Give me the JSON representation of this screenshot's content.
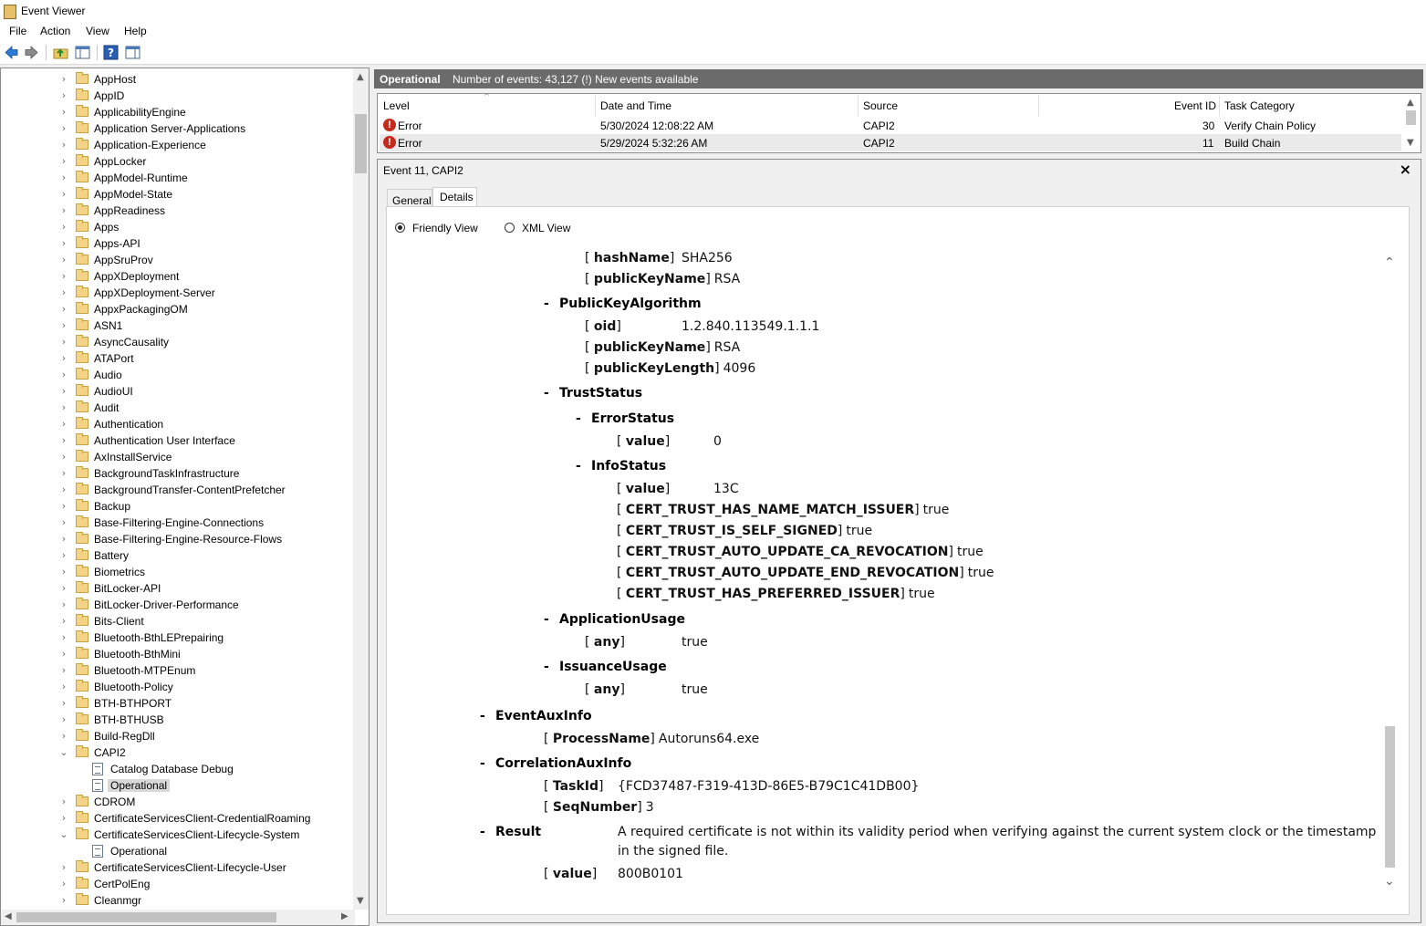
{
  "window": {
    "title": "Event Viewer"
  },
  "menu": [
    "File",
    "Action",
    "View",
    "Help"
  ],
  "toolbar": [
    "back-icon",
    "forward-icon",
    "folder-up-icon",
    "console-tree-icon",
    "help-icon",
    "action-pane-icon"
  ],
  "tree": {
    "items": [
      {
        "label": "AppHost",
        "type": "folder",
        "expanded": false
      },
      {
        "label": "AppID",
        "type": "folder",
        "expanded": false
      },
      {
        "label": "ApplicabilityEngine",
        "type": "folder",
        "expanded": false
      },
      {
        "label": "Application Server-Applications",
        "type": "folder",
        "expanded": false
      },
      {
        "label": "Application-Experience",
        "type": "folder",
        "expanded": false
      },
      {
        "label": "AppLocker",
        "type": "folder",
        "expanded": false
      },
      {
        "label": "AppModel-Runtime",
        "type": "folder",
        "expanded": false
      },
      {
        "label": "AppModel-State",
        "type": "folder",
        "expanded": false
      },
      {
        "label": "AppReadiness",
        "type": "folder",
        "expanded": false
      },
      {
        "label": "Apps",
        "type": "folder",
        "expanded": false
      },
      {
        "label": "Apps-API",
        "type": "folder",
        "expanded": false
      },
      {
        "label": "AppSruProv",
        "type": "folder",
        "expanded": false
      },
      {
        "label": "AppXDeployment",
        "type": "folder",
        "expanded": false
      },
      {
        "label": "AppXDeployment-Server",
        "type": "folder",
        "expanded": false
      },
      {
        "label": "AppxPackagingOM",
        "type": "folder",
        "expanded": false
      },
      {
        "label": "ASN1",
        "type": "folder",
        "expanded": false
      },
      {
        "label": "AsyncCausality",
        "type": "folder",
        "expanded": false
      },
      {
        "label": "ATAPort",
        "type": "folder",
        "expanded": false
      },
      {
        "label": "Audio",
        "type": "folder",
        "expanded": false
      },
      {
        "label": "AudioUI",
        "type": "folder",
        "expanded": false
      },
      {
        "label": "Audit",
        "type": "folder",
        "expanded": false
      },
      {
        "label": "Authentication",
        "type": "folder",
        "expanded": false
      },
      {
        "label": "Authentication User Interface",
        "type": "folder",
        "expanded": false
      },
      {
        "label": "AxInstallService",
        "type": "folder",
        "expanded": false
      },
      {
        "label": "BackgroundTaskInfrastructure",
        "type": "folder",
        "expanded": false
      },
      {
        "label": "BackgroundTransfer-ContentPrefetcher",
        "type": "folder",
        "expanded": false
      },
      {
        "label": "Backup",
        "type": "folder",
        "expanded": false
      },
      {
        "label": "Base-Filtering-Engine-Connections",
        "type": "folder",
        "expanded": false
      },
      {
        "label": "Base-Filtering-Engine-Resource-Flows",
        "type": "folder",
        "expanded": false
      },
      {
        "label": "Battery",
        "type": "folder",
        "expanded": false
      },
      {
        "label": "Biometrics",
        "type": "folder",
        "expanded": false
      },
      {
        "label": "BitLocker-API",
        "type": "folder",
        "expanded": false
      },
      {
        "label": "BitLocker-Driver-Performance",
        "type": "folder",
        "expanded": false
      },
      {
        "label": "Bits-Client",
        "type": "folder",
        "expanded": false
      },
      {
        "label": "Bluetooth-BthLEPrepairing",
        "type": "folder",
        "expanded": false
      },
      {
        "label": "Bluetooth-BthMini",
        "type": "folder",
        "expanded": false
      },
      {
        "label": "Bluetooth-MTPEnum",
        "type": "folder",
        "expanded": false
      },
      {
        "label": "Bluetooth-Policy",
        "type": "folder",
        "expanded": false
      },
      {
        "label": "BTH-BTHPORT",
        "type": "folder",
        "expanded": false
      },
      {
        "label": "BTH-BTHUSB",
        "type": "folder",
        "expanded": false
      },
      {
        "label": "Build-RegDll",
        "type": "folder",
        "expanded": false
      },
      {
        "label": "CAPI2",
        "type": "folder",
        "expanded": true
      },
      {
        "label": "Catalog Database Debug",
        "type": "log-debug",
        "child": true
      },
      {
        "label": "Operational",
        "type": "log",
        "child": true,
        "selected": true
      },
      {
        "label": "CDROM",
        "type": "folder",
        "expanded": false
      },
      {
        "label": "CertificateServicesClient-CredentialRoaming",
        "type": "folder",
        "expanded": false
      },
      {
        "label": "CertificateServicesClient-Lifecycle-System",
        "type": "folder",
        "expanded": true
      },
      {
        "label": "Operational",
        "type": "log",
        "child": true
      },
      {
        "label": "CertificateServicesClient-Lifecycle-User",
        "type": "folder",
        "expanded": false
      },
      {
        "label": "CertPolEng",
        "type": "folder",
        "expanded": false
      },
      {
        "label": "Cleanmgr",
        "type": "folder",
        "expanded": false
      }
    ]
  },
  "log_header": {
    "name": "Operational",
    "info": "Number of events: 43,127 (!) New events available"
  },
  "event_list": {
    "columns": [
      "Level",
      "Date and Time",
      "Source",
      "Event ID",
      "Task Category"
    ],
    "rows": [
      {
        "level": "Error",
        "datetime": "5/30/2024 12:08:22 AM",
        "source": "CAPI2",
        "event_id": "30",
        "task": "Verify Chain Policy"
      },
      {
        "level": "Error",
        "datetime": "5/29/2024 5:32:26 AM",
        "source": "CAPI2",
        "event_id": "11",
        "task": "Build Chain"
      }
    ]
  },
  "event_detail": {
    "title": "Event 11, CAPI2",
    "tabs": [
      "General",
      "Details"
    ],
    "active_tab": "Details",
    "views": [
      "Friendly View",
      "XML View"
    ],
    "selected_view": "Friendly View",
    "lines": [
      {
        "kind": "kv",
        "indent": 3,
        "key": "hashName",
        "value": "SHA256",
        "vcol": 306
      },
      {
        "kind": "kv",
        "indent": 3,
        "key": "publicKeyName",
        "value": "RSA"
      },
      {
        "kind": "sec",
        "indent": 2,
        "key": "PublicKeyAlgorithm"
      },
      {
        "kind": "kv",
        "indent": 3,
        "key": "oid",
        "value": "1.2.840.113549.1.1.1",
        "vcol": 306
      },
      {
        "kind": "kv",
        "indent": 3,
        "key": "publicKeyName",
        "value": "RSA"
      },
      {
        "kind": "kv",
        "indent": 3,
        "key": "publicKeyLength",
        "value": "4096"
      },
      {
        "kind": "sec",
        "indent": 2,
        "key": "TrustStatus"
      },
      {
        "kind": "sec",
        "indent": 3,
        "key": "ErrorStatus"
      },
      {
        "kind": "kv",
        "indent": 4,
        "key": "value",
        "value": "0",
        "vcol": 341
      },
      {
        "kind": "sec",
        "indent": 3,
        "key": "InfoStatus"
      },
      {
        "kind": "kv",
        "indent": 4,
        "key": "value",
        "value": "13C",
        "vcol": 341
      },
      {
        "kind": "kv",
        "indent": 4,
        "key": "CERT_TRUST_HAS_NAME_MATCH_ISSUER",
        "value": "true"
      },
      {
        "kind": "kv",
        "indent": 4,
        "key": "CERT_TRUST_IS_SELF_SIGNED",
        "value": "true"
      },
      {
        "kind": "kv",
        "indent": 4,
        "key": "CERT_TRUST_AUTO_UPDATE_CA_REVOCATION",
        "value": "true"
      },
      {
        "kind": "kv",
        "indent": 4,
        "key": "CERT_TRUST_AUTO_UPDATE_END_REVOCATION",
        "value": "true"
      },
      {
        "kind": "kv",
        "indent": 4,
        "key": "CERT_TRUST_HAS_PREFERRED_ISSUER",
        "value": "true"
      },
      {
        "kind": "sec",
        "indent": 2,
        "key": "ApplicationUsage"
      },
      {
        "kind": "kv",
        "indent": 3,
        "key": "any",
        "value": "true",
        "vcol": 306
      },
      {
        "kind": "sec",
        "indent": 2,
        "key": "IssuanceUsage"
      },
      {
        "kind": "kv",
        "indent": 3,
        "key": "any",
        "value": "true",
        "vcol": 306
      },
      {
        "kind": "sec",
        "indent": 1,
        "key": "EventAuxInfo"
      },
      {
        "kind": "kv",
        "indent": 2,
        "key": "ProcessName",
        "value": "Autoruns64.exe"
      },
      {
        "kind": "sec",
        "indent": 1,
        "key": "CorrelationAuxInfo"
      },
      {
        "kind": "kv",
        "indent": 2,
        "key": "TaskId",
        "value": "{FCD37487-F319-413D-86E5-B79C1C41DB00}",
        "vcol": 236
      },
      {
        "kind": "kv",
        "indent": 2,
        "key": "SeqNumber",
        "value": "3"
      },
      {
        "kind": "result",
        "indent": 1,
        "key": "Result",
        "value": "A required certificate is not within its validity period when verifying against the current system clock or the timestamp",
        "value2": "in the signed file."
      },
      {
        "kind": "kv",
        "indent": 2,
        "key": "value",
        "value": "800B0101",
        "vcol": 236
      }
    ]
  }
}
